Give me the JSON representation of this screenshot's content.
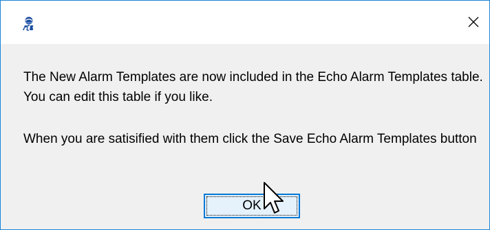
{
  "dialog": {
    "app_icon": "pcb-logo-icon",
    "close_icon": "close-icon",
    "message_line1": "The New Alarm Templates are now included in the Echo Alarm Templates table. You can edit this table if you like.",
    "message_line2": "When you are satisified with them click the Save Echo Alarm Templates button",
    "ok_label": "OK",
    "cursor_icon": "mouse-pointer-icon"
  },
  "colors": {
    "window_border": "#1883d7",
    "body_background": "#f0f0f0",
    "button_border": "#0078d7",
    "button_background": "#e5f1fb"
  }
}
